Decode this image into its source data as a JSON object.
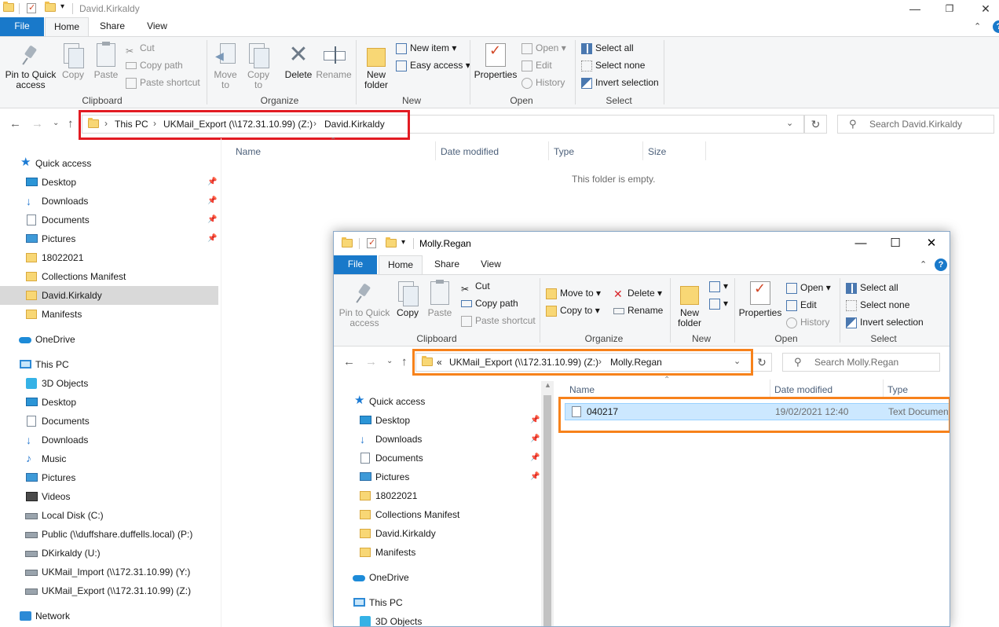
{
  "back": {
    "title": "David.Kirkaldy",
    "tabs": {
      "file": "File",
      "home": "Home",
      "share": "Share",
      "view": "View"
    },
    "ribbon": {
      "pin": "Pin to Quick access",
      "copy": "Copy",
      "paste": "Paste",
      "cut": "Cut",
      "copy_path": "Copy path",
      "paste_shortcut": "Paste shortcut",
      "move_to": "Move to",
      "copy_to": "Copy to",
      "delete": "Delete",
      "rename": "Rename",
      "new_folder": "New folder",
      "new_item": "New item",
      "easy_access": "Easy access",
      "properties": "Properties",
      "open": "Open",
      "edit": "Edit",
      "history": "History",
      "select_all": "Select all",
      "select_none": "Select none",
      "invert_selection": "Invert selection",
      "groups": {
        "clipboard": "Clipboard",
        "organize": "Organize",
        "new": "New",
        "open": "Open",
        "select": "Select"
      }
    },
    "breadcrumb": [
      "This PC",
      "UKMail_Export (\\\\172.31.10.99) (Z:)",
      "David.Kirkaldy"
    ],
    "search_placeholder": "Search David.Kirkaldy",
    "columns": {
      "name": "Name",
      "date": "Date modified",
      "type": "Type",
      "size": "Size"
    },
    "empty_text": "This folder is empty.",
    "nav": {
      "quick_access": "Quick access",
      "qa_items": [
        "Desktop",
        "Downloads",
        "Documents",
        "Pictures",
        "18022021",
        "Collections Manifest",
        "David.Kirkaldy",
        "Manifests"
      ],
      "onedrive": "OneDrive",
      "this_pc": "This PC",
      "pc_items": [
        "3D Objects",
        "Desktop",
        "Documents",
        "Downloads",
        "Music",
        "Pictures",
        "Videos",
        "Local Disk (C:)",
        "Public (\\\\duffshare.duffells.local) (P:)",
        "DKirkaldy (U:)",
        "UKMail_Import (\\\\172.31.10.99) (Y:)",
        "UKMail_Export (\\\\172.31.10.99) (Z:)"
      ],
      "network": "Network"
    }
  },
  "front": {
    "title": "Molly.Regan",
    "tabs": {
      "file": "File",
      "home": "Home",
      "share": "Share",
      "view": "View"
    },
    "ribbon": {
      "pin": "Pin to Quick access",
      "copy": "Copy",
      "paste": "Paste",
      "cut": "Cut",
      "copy_path": "Copy path",
      "paste_shortcut": "Paste shortcut",
      "move_to": "Move to",
      "copy_to": "Copy to",
      "delete": "Delete",
      "rename": "Rename",
      "new_folder": "New folder",
      "properties": "Properties",
      "open": "Open",
      "edit": "Edit",
      "history": "History",
      "select_all": "Select all",
      "select_none": "Select none",
      "invert_selection": "Invert selection",
      "groups": {
        "clipboard": "Clipboard",
        "organize": "Organize",
        "new": "New",
        "open": "Open",
        "select": "Select"
      }
    },
    "breadcrumb_prefix": "«",
    "breadcrumb": [
      "UKMail_Export (\\\\172.31.10.99) (Z:)",
      "Molly.Regan"
    ],
    "search_placeholder": "Search Molly.Regan",
    "columns": {
      "name": "Name",
      "date": "Date modified",
      "type": "Type"
    },
    "files": [
      {
        "name": "040217",
        "date": "19/02/2021 12:40",
        "type": "Text Document"
      }
    ],
    "nav": {
      "quick_access": "Quick access",
      "qa_items": [
        "Desktop",
        "Downloads",
        "Documents",
        "Pictures",
        "18022021",
        "Collections Manifest",
        "David.Kirkaldy",
        "Manifests"
      ],
      "onedrive": "OneDrive",
      "this_pc": "This PC",
      "pc_items": [
        "3D Objects"
      ]
    }
  },
  "colors": {
    "file_tab": "#1979ca",
    "highlight_red": "#e21b23",
    "highlight_orange": "#f7821b",
    "selection": "#cce8ff"
  }
}
